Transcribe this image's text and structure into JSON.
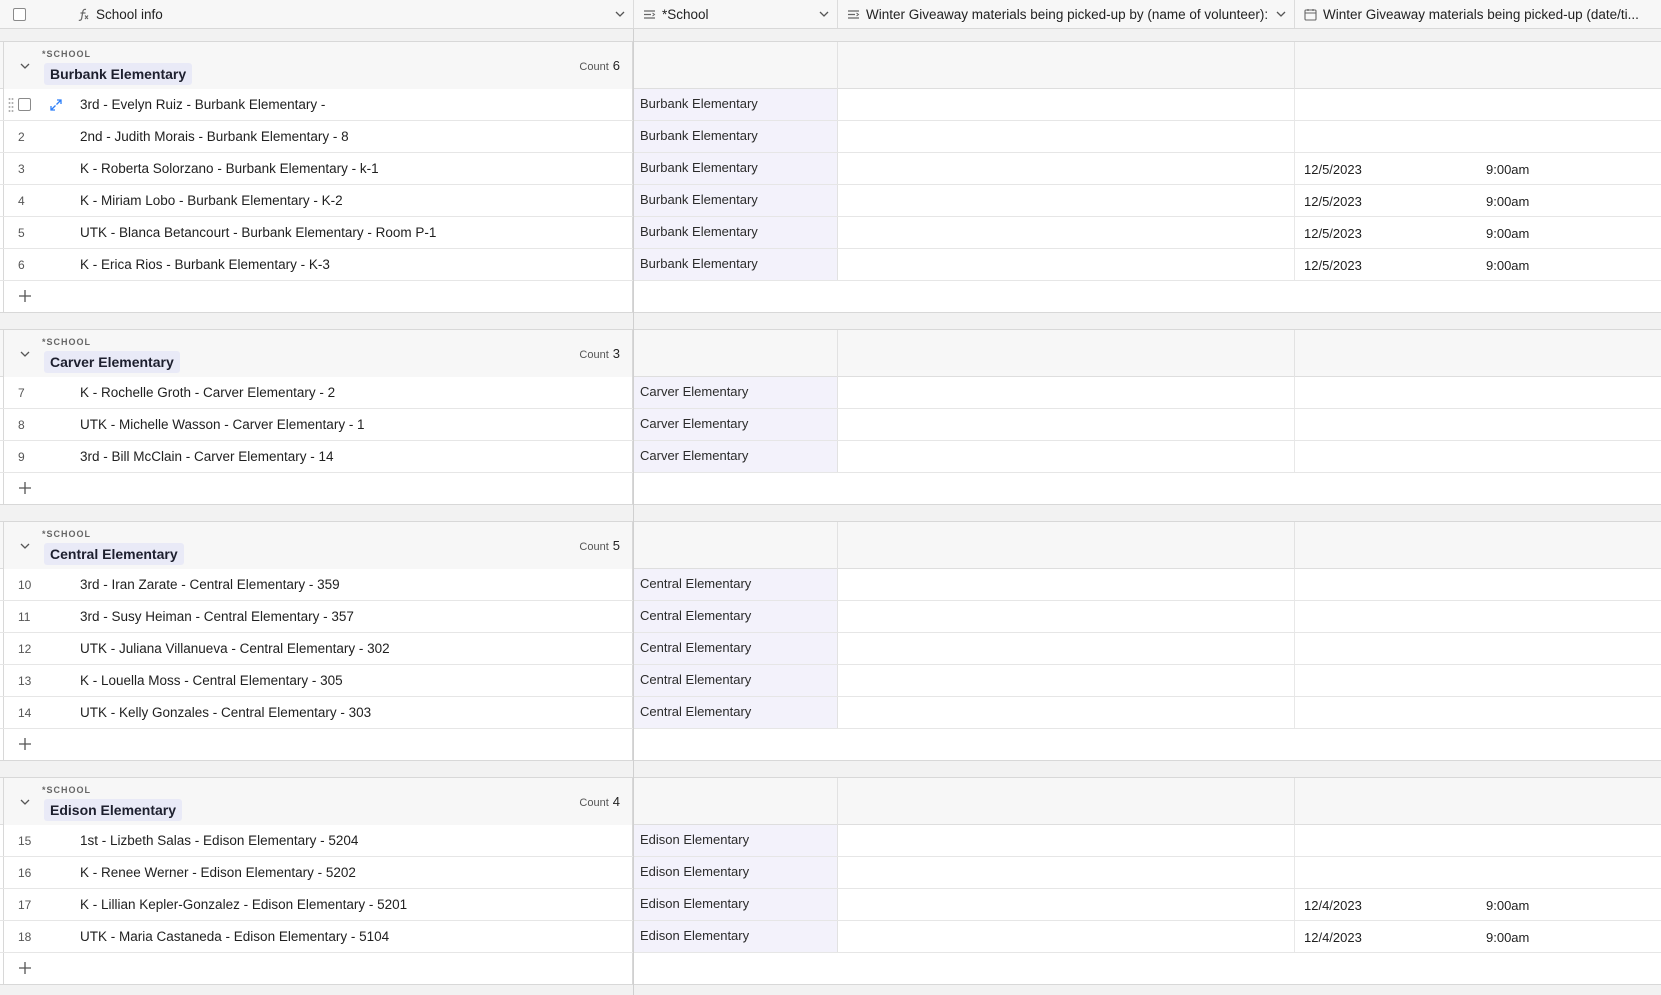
{
  "columns": {
    "school_info": "School info",
    "school": "*School",
    "volunteer": "Winter Giveaway materials being picked-up by (name of volunteer):",
    "pickup": "Winter Giveaway materials being picked-up (date/ti..."
  },
  "group_field_label": "*SCHOOL",
  "count_label": "Count",
  "groups": [
    {
      "name": "Burbank Elementary",
      "count": "6",
      "rows": [
        {
          "num": "",
          "info": "3rd - Evelyn Ruiz - Burbank Elementary -",
          "school": "Burbank Elementary",
          "date": "",
          "time": ""
        },
        {
          "num": "2",
          "info": "2nd - Judith Morais - Burbank Elementary - 8",
          "school": "Burbank Elementary",
          "date": "",
          "time": ""
        },
        {
          "num": "3",
          "info": "K - Roberta Solorzano - Burbank Elementary - k-1",
          "school": "Burbank Elementary",
          "date": "12/5/2023",
          "time": "9:00am"
        },
        {
          "num": "4",
          "info": "K - Miriam Lobo - Burbank Elementary - K-2",
          "school": "Burbank Elementary",
          "date": "12/5/2023",
          "time": "9:00am"
        },
        {
          "num": "5",
          "info": "UTK - Blanca Betancourt - Burbank Elementary - Room P-1",
          "school": "Burbank Elementary",
          "date": "12/5/2023",
          "time": "9:00am"
        },
        {
          "num": "6",
          "info": "K - Erica Rios - Burbank Elementary - K-3",
          "school": "Burbank Elementary",
          "date": "12/5/2023",
          "time": "9:00am"
        }
      ]
    },
    {
      "name": "Carver Elementary",
      "count": "3",
      "rows": [
        {
          "num": "7",
          "info": "K - Rochelle Groth - Carver Elementary - 2",
          "school": "Carver Elementary",
          "date": "",
          "time": ""
        },
        {
          "num": "8",
          "info": "UTK - Michelle Wasson - Carver Elementary - 1",
          "school": "Carver Elementary",
          "date": "",
          "time": ""
        },
        {
          "num": "9",
          "info": "3rd - Bill McClain - Carver Elementary - 14",
          "school": "Carver Elementary",
          "date": "",
          "time": ""
        }
      ]
    },
    {
      "name": "Central Elementary",
      "count": "5",
      "rows": [
        {
          "num": "10",
          "info": "3rd - Iran Zarate - Central Elementary - 359",
          "school": "Central Elementary",
          "date": "",
          "time": ""
        },
        {
          "num": "11",
          "info": "3rd - Susy Heiman - Central Elementary - 357",
          "school": "Central Elementary",
          "date": "",
          "time": ""
        },
        {
          "num": "12",
          "info": "UTK - Juliana Villanueva - Central Elementary - 302",
          "school": "Central Elementary",
          "date": "",
          "time": ""
        },
        {
          "num": "13",
          "info": "K - Louella Moss - Central Elementary - 305",
          "school": "Central Elementary",
          "date": "",
          "time": ""
        },
        {
          "num": "14",
          "info": "UTK - Kelly Gonzales - Central Elementary - 303",
          "school": "Central Elementary",
          "date": "",
          "time": ""
        }
      ]
    },
    {
      "name": "Edison Elementary",
      "count": "4",
      "rows": [
        {
          "num": "15",
          "info": "1st - Lizbeth Salas - Edison Elementary - 5204",
          "school": "Edison Elementary",
          "date": "",
          "time": ""
        },
        {
          "num": "16",
          "info": "K - Renee Werner - Edison Elementary - 5202",
          "school": "Edison Elementary",
          "date": "",
          "time": ""
        },
        {
          "num": "17",
          "info": "K - Lillian Kepler-Gonzalez - Edison Elementary - 5201",
          "school": "Edison Elementary",
          "date": "12/4/2023",
          "time": "9:00am"
        },
        {
          "num": "18",
          "info": "UTK - Maria Castaneda - Edison Elementary - 5104",
          "school": "Edison Elementary",
          "date": "12/4/2023",
          "time": "9:00am"
        }
      ]
    }
  ]
}
